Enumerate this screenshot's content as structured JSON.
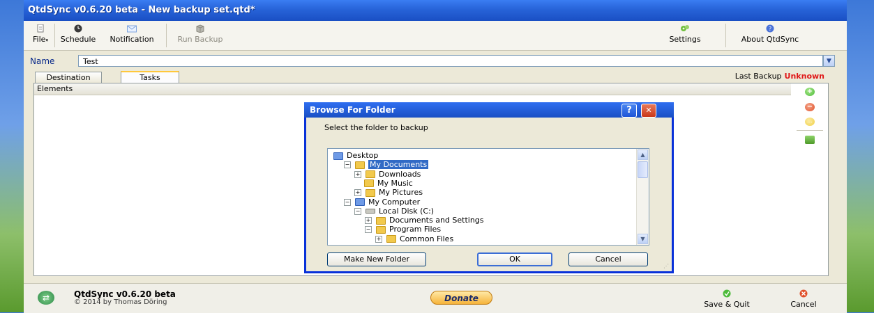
{
  "window": {
    "title": "QtdSync v0.6.20 beta - New backup set.qtd*"
  },
  "toolbar": {
    "file": "File",
    "schedule": "Schedule",
    "notification": "Notification",
    "run_backup": "Run Backup",
    "settings": "Settings",
    "about": "About QtdSync"
  },
  "name_row": {
    "label": "Name",
    "value": "Test"
  },
  "tabs": [
    "Destination",
    "Tasks"
  ],
  "last_backup": {
    "label": "Last Backup",
    "value": "Unknown"
  },
  "elements_header": "Elements",
  "dialog": {
    "title": "Browse For Folder",
    "help": "?",
    "close": "✕",
    "prompt": "Select the folder to backup",
    "tree": [
      {
        "label": "Desktop",
        "level": 0,
        "expander": "",
        "icon": "desktop-icon",
        "selected": false
      },
      {
        "label": "My Documents",
        "level": 1,
        "expander": "−",
        "icon": "my-documents-icon",
        "selected": true
      },
      {
        "label": "Downloads",
        "level": 2,
        "expander": "+",
        "icon": "folder-icon",
        "selected": false
      },
      {
        "label": "My Music",
        "level": 2,
        "expander": "",
        "icon": "my-music-icon",
        "selected": false
      },
      {
        "label": "My Pictures",
        "level": 2,
        "expander": "+",
        "icon": "my-pictures-icon",
        "selected": false
      },
      {
        "label": "My Computer",
        "level": 1,
        "expander": "−",
        "icon": "my-computer-icon",
        "selected": false
      },
      {
        "label": "Local Disk (C:)",
        "level": 2,
        "expander": "−",
        "icon": "local-disk-icon",
        "selected": false
      },
      {
        "label": "Documents and Settings",
        "level": 3,
        "expander": "+",
        "icon": "folder-icon",
        "selected": false
      },
      {
        "label": "Program Files",
        "level": 3,
        "expander": "−",
        "icon": "folder-icon",
        "selected": false
      },
      {
        "label": "Common Files",
        "level": 4,
        "expander": "+",
        "icon": "folder-icon",
        "selected": false
      }
    ],
    "make_new_folder": "Make New Folder",
    "ok": "OK",
    "cancel": "Cancel"
  },
  "bottom": {
    "app_name": "QtdSync v0.6.20 beta",
    "copyright": "© 2014 by Thomas Döring",
    "donate": "Donate",
    "save_quit": "Save & Quit",
    "cancel": "Cancel"
  },
  "colors": {
    "title_blue": "#2763d8",
    "last_backup_red": "#e01818",
    "add_green": "#4cbb3a",
    "remove_red": "#e0502a",
    "edit_yellow": "#f1d24a",
    "selection_blue": "#316ac5"
  }
}
